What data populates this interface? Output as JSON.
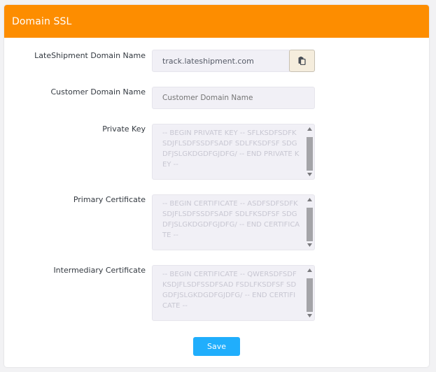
{
  "header": {
    "title": "Domain SSL"
  },
  "form": {
    "lateshipment_domain": {
      "label": "LateShipment Domain Name",
      "value": "track.lateshipment.com",
      "copy_icon": "clipboard-icon"
    },
    "customer_domain": {
      "label": "Customer Domain Name",
      "placeholder": "Customer Domain Name"
    },
    "private_key": {
      "label": "Private Key",
      "placeholder": "-- BEGIN PRIVATE KEY -- SFLKSDFSDFKSDJFLSDFSSDFSADF SDLFKSDFSF SDGDFJSLGKDGDFGJDFG/ -- END PRIVATE KEY --"
    },
    "primary_certificate": {
      "label": "Primary Certificate",
      "placeholder": "-- BEGIN CERTIFICATE -- ASDFSDFSDFKSDJFLSDFSSDFSADF SDLFKSDFSF SDGDFJSLGKDGDFGJDFG/ -- END CERTIFICATE --"
    },
    "intermediary_certificate": {
      "label": "Intermediary Certificate",
      "placeholder": "-- BEGIN CERTIFICATE -- QWERSDFSDFKSDJFLSDFSSDFSAD FSDLFKSDFSF SDGDFJSLGKDGDFGJDFG/ -- END CERTIFICATE --"
    },
    "save_label": "Save"
  },
  "colors": {
    "header": "#fd8d00",
    "save_button": "#20aefc",
    "field_background": "#f1f0f6"
  }
}
